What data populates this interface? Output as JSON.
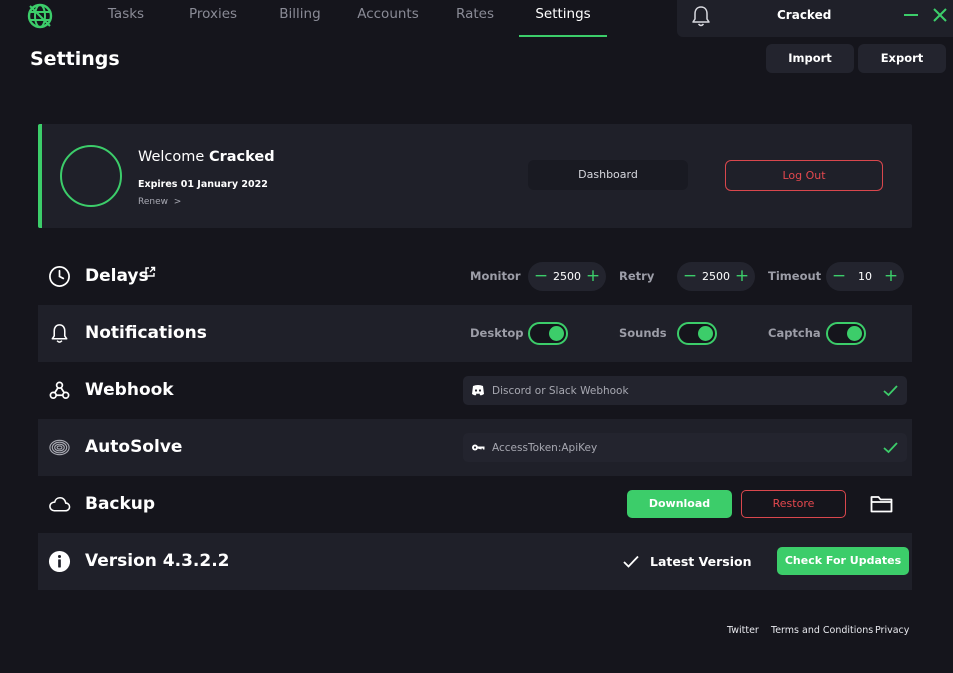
{
  "nav": {
    "tabs": [
      {
        "label": "Tasks"
      },
      {
        "label": "Proxies"
      },
      {
        "label": "Billing"
      },
      {
        "label": "Accounts"
      },
      {
        "label": "Rates"
      },
      {
        "label": "Settings"
      }
    ],
    "active_tab": "Settings",
    "user": "Cracked"
  },
  "header": {
    "title": "Settings",
    "import_label": "Import",
    "export_label": "Export"
  },
  "welcome": {
    "greeting": "Welcome",
    "username": "Cracked",
    "expires": "Expires 01 January 2022",
    "renew": "Renew  >",
    "dashboard_label": "Dashboard",
    "logout_label": "Log Out"
  },
  "delays": {
    "label": "Delays",
    "monitor_label": "Monitor",
    "monitor_value": "2500",
    "retry_label": "Retry",
    "retry_value": "2500",
    "timeout_label": "Timeout",
    "timeout_value": "10"
  },
  "notifications": {
    "label": "Notifications",
    "desktop_label": "Desktop",
    "sounds_label": "Sounds",
    "captcha_label": "Captcha",
    "desktop_on": true,
    "sounds_on": true,
    "captcha_on": true
  },
  "webhook": {
    "label": "Webhook",
    "placeholder": "Discord or Slack Webhook"
  },
  "autosolve": {
    "label": "AutoSolve",
    "placeholder": "AccessToken:ApiKey"
  },
  "backup": {
    "label": "Backup",
    "download_label": "Download",
    "restore_label": "Restore"
  },
  "version": {
    "label": "Version 4.3.2.2",
    "status": "Latest Version",
    "check_label": "Check For Updates"
  },
  "footer": {
    "twitter": "Twitter",
    "terms": "Terms and Conditions",
    "privacy": "Privacy"
  },
  "colors": {
    "accent": "#3ccd6a",
    "danger": "#e4484e",
    "background": "#15151c",
    "panel": "#1f2029"
  }
}
